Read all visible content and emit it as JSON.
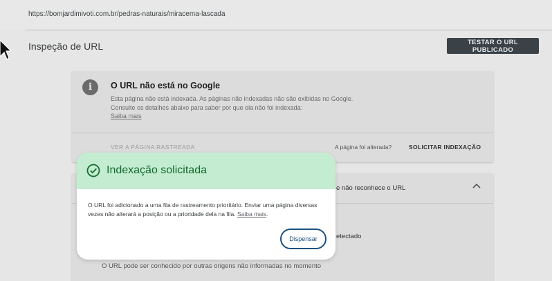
{
  "url_bar": {
    "url": "https://bomjardimivoti.com.br/pedras-naturais/miracema-lascada"
  },
  "header": {
    "title": "Inspeção de URL",
    "test_button": "TESTAR O URL PUBLICADO"
  },
  "status_card": {
    "icon": "info-icon",
    "title": "O URL não está no Google",
    "description": "Esta página não está indexada. As páginas não indexadas não são exibidas no Google. Consulte os detalhes abaixo para saber por que ela não foi indexada:",
    "learn_more": "Saiba mais",
    "crawled_page_link": "VER A PÁGINA RASTREADA",
    "page_changed_question": "A página foi alterada?",
    "request_indexing": "SOLICITAR INDEXAÇÃO"
  },
  "details_card": {
    "header_partial": "e não reconhece o URL",
    "detected_partial": "etectado",
    "origins_text": "O URL pode ser conhecido por outras origens não informadas no momento"
  },
  "modal": {
    "icon": "check-circle-icon",
    "title": "Indexação solicitada",
    "body": "O URL foi adicionado a uma fila de rastreamento prioritário. Enviar uma página diversas vezes não alterará a posição ou a prioridade dela na fila.",
    "learn_more": "Saiba mais",
    "body_end": ".",
    "dismiss": "Dispensar",
    "header_color": "#c3ecd1",
    "title_color": "#146c2e"
  }
}
